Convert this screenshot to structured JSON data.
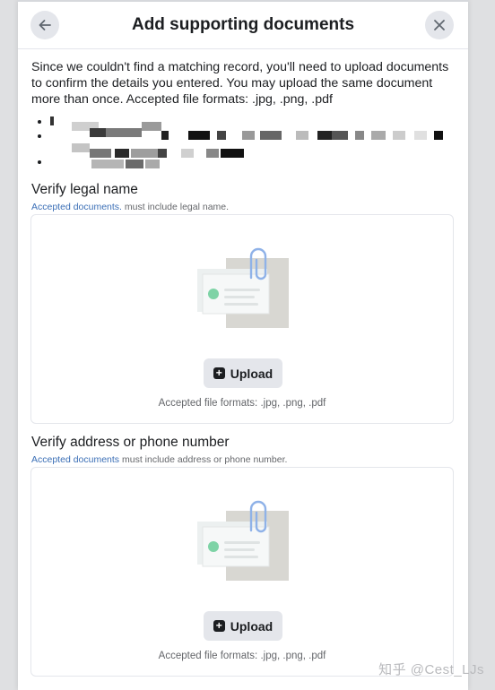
{
  "dialog": {
    "title": "Add supporting documents",
    "back_icon": "arrow-left-icon",
    "close_icon": "close-icon"
  },
  "description": "Since we couldn't find a matching record, you'll need to upload documents to confirm the details you entered. You may upload the same document more than once. Accepted file formats: .jpg, .png, .pdf",
  "sections": [
    {
      "title": "Verify legal name",
      "link": "Accepted documents.",
      "note": " must include legal name.",
      "upload_label": "Upload",
      "formats": "Accepted file formats: .jpg, .png, .pdf"
    },
    {
      "title": "Verify address or phone number",
      "link": "Accepted documents",
      "note": " must include address or phone number.",
      "upload_label": "Upload",
      "formats": "Accepted file formats: .jpg, .png, .pdf"
    }
  ],
  "watermark": "知乎 @Cest_LJs",
  "colors": {
    "link": "#3b6fb6",
    "button_bg": "#e4e6eb",
    "accent_green": "#7ed3a6",
    "clip_blue": "#8fb2e8"
  }
}
